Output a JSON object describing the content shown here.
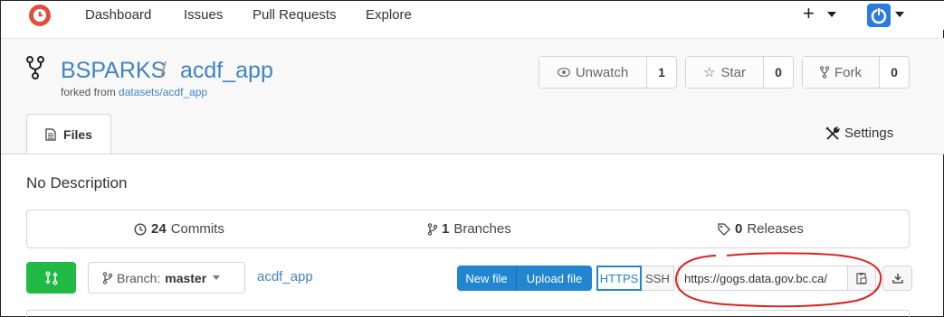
{
  "nav": {
    "items": [
      "Dashboard",
      "Issues",
      "Pull Requests",
      "Explore"
    ],
    "plus": "+"
  },
  "repo": {
    "owner": "BSPARKS",
    "separator": "/",
    "name": "acdf_app",
    "forked_prefix": "forked from",
    "forked_link": "datasets/acdf_app"
  },
  "actions": {
    "watch": {
      "label": "Unwatch",
      "count": "1"
    },
    "star": {
      "label": "Star",
      "count": "0"
    },
    "fork": {
      "label": "Fork",
      "count": "0"
    }
  },
  "tabs": {
    "files": "Files",
    "settings": "Settings"
  },
  "description": "No Description",
  "stats": {
    "commits_count": "24",
    "commits_label": "Commits",
    "branches_count": "1",
    "branches_label": "Branches",
    "releases_count": "0",
    "releases_label": "Releases"
  },
  "toolbar": {
    "branch_prefix": "Branch:",
    "branch_name": "master",
    "breadcrumb": "acdf_app",
    "new_file": "New file",
    "upload_file": "Upload file",
    "https": "HTTPS",
    "ssh": "SSH",
    "clone_url": "https://gogs.data.gov.bc.ca/"
  },
  "colors": {
    "link": "#4183c4",
    "primary": "#2185d0",
    "green": "#21ba45",
    "annotation": "#e02020"
  }
}
